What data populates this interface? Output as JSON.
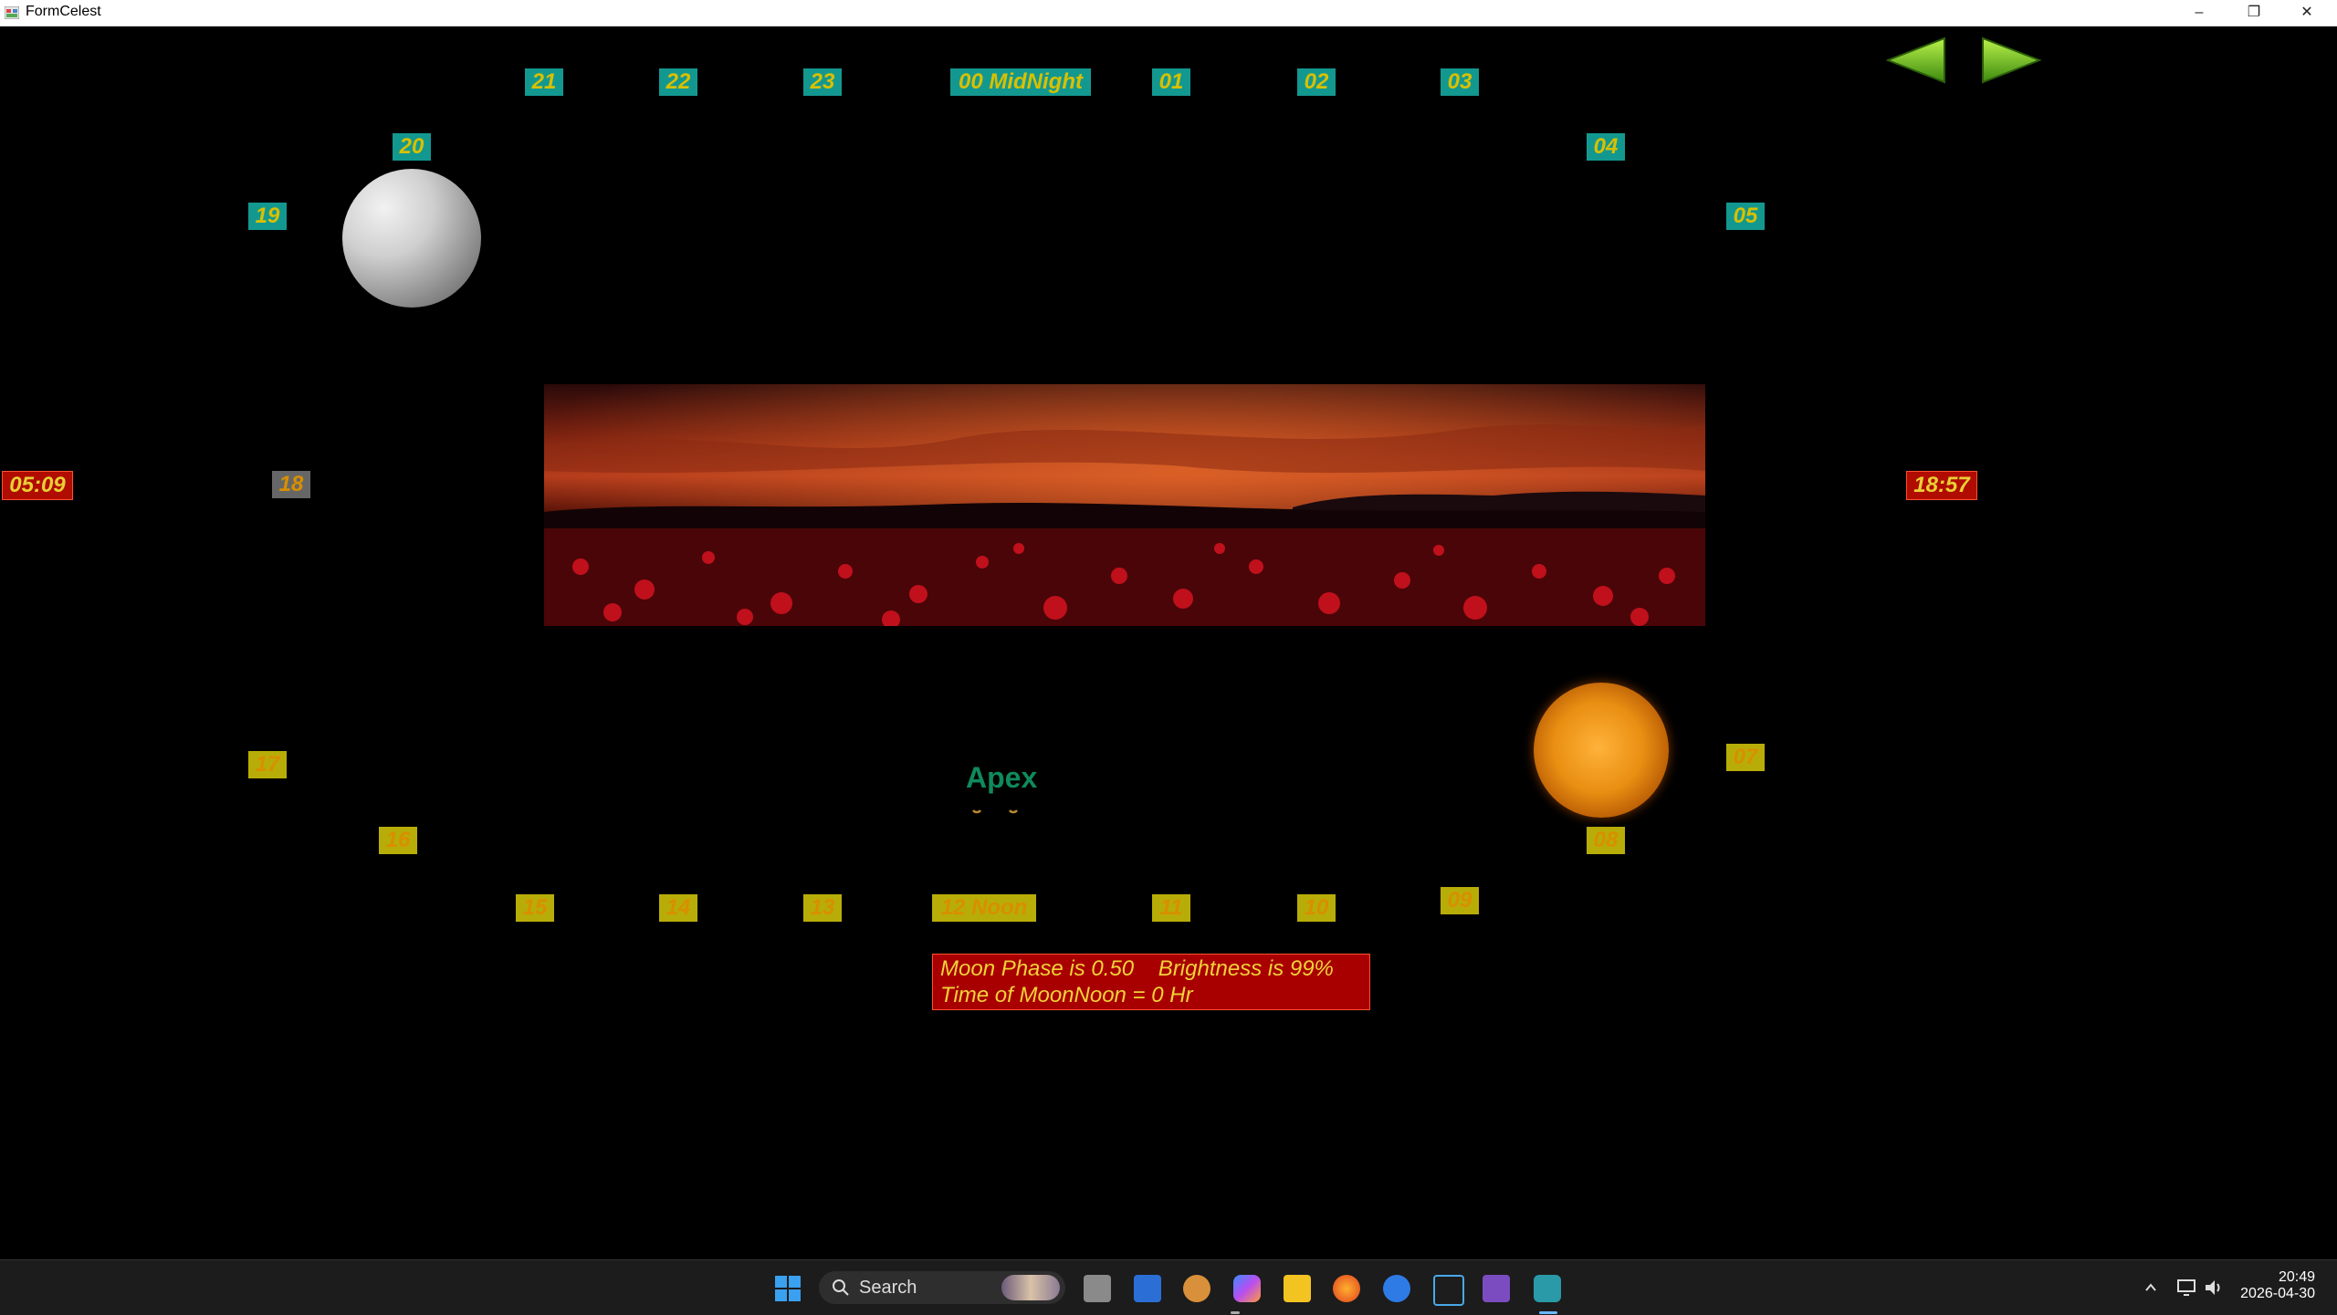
{
  "window": {
    "title": "FormCelest",
    "minimize": "–",
    "restore": "❐",
    "close": "✕"
  },
  "hours": {
    "h21": "21",
    "h22": "22",
    "h23": "23",
    "h00": "00 MidNight",
    "h01": "01",
    "h02": "02",
    "h03": "03",
    "h04": "04",
    "h05": "05",
    "h20": "20",
    "h19": "19",
    "h18": "18",
    "h17": "17",
    "h16": "16",
    "h15": "15",
    "h14": "14",
    "h13": "13",
    "h12": "12 Noon",
    "h11": "11",
    "h10": "10",
    "h09": "09",
    "h08": "08",
    "h07": "07"
  },
  "sunrise_time": "05:09",
  "sunset_time": "18:57",
  "apex_label": "Apex",
  "info": {
    "line1": "Moon Phase is 0.50    Brightness is 99%",
    "line2": "Time of MoonNoon = 0 Hr"
  },
  "taskbar": {
    "search_label": "Search",
    "time": "20:49",
    "date": "2026-04-30"
  },
  "colors": {
    "night_tile": "#139890",
    "day_tile": "#b8ad08",
    "red_tile": "#b10c00",
    "apex": "#0f8a5c"
  }
}
